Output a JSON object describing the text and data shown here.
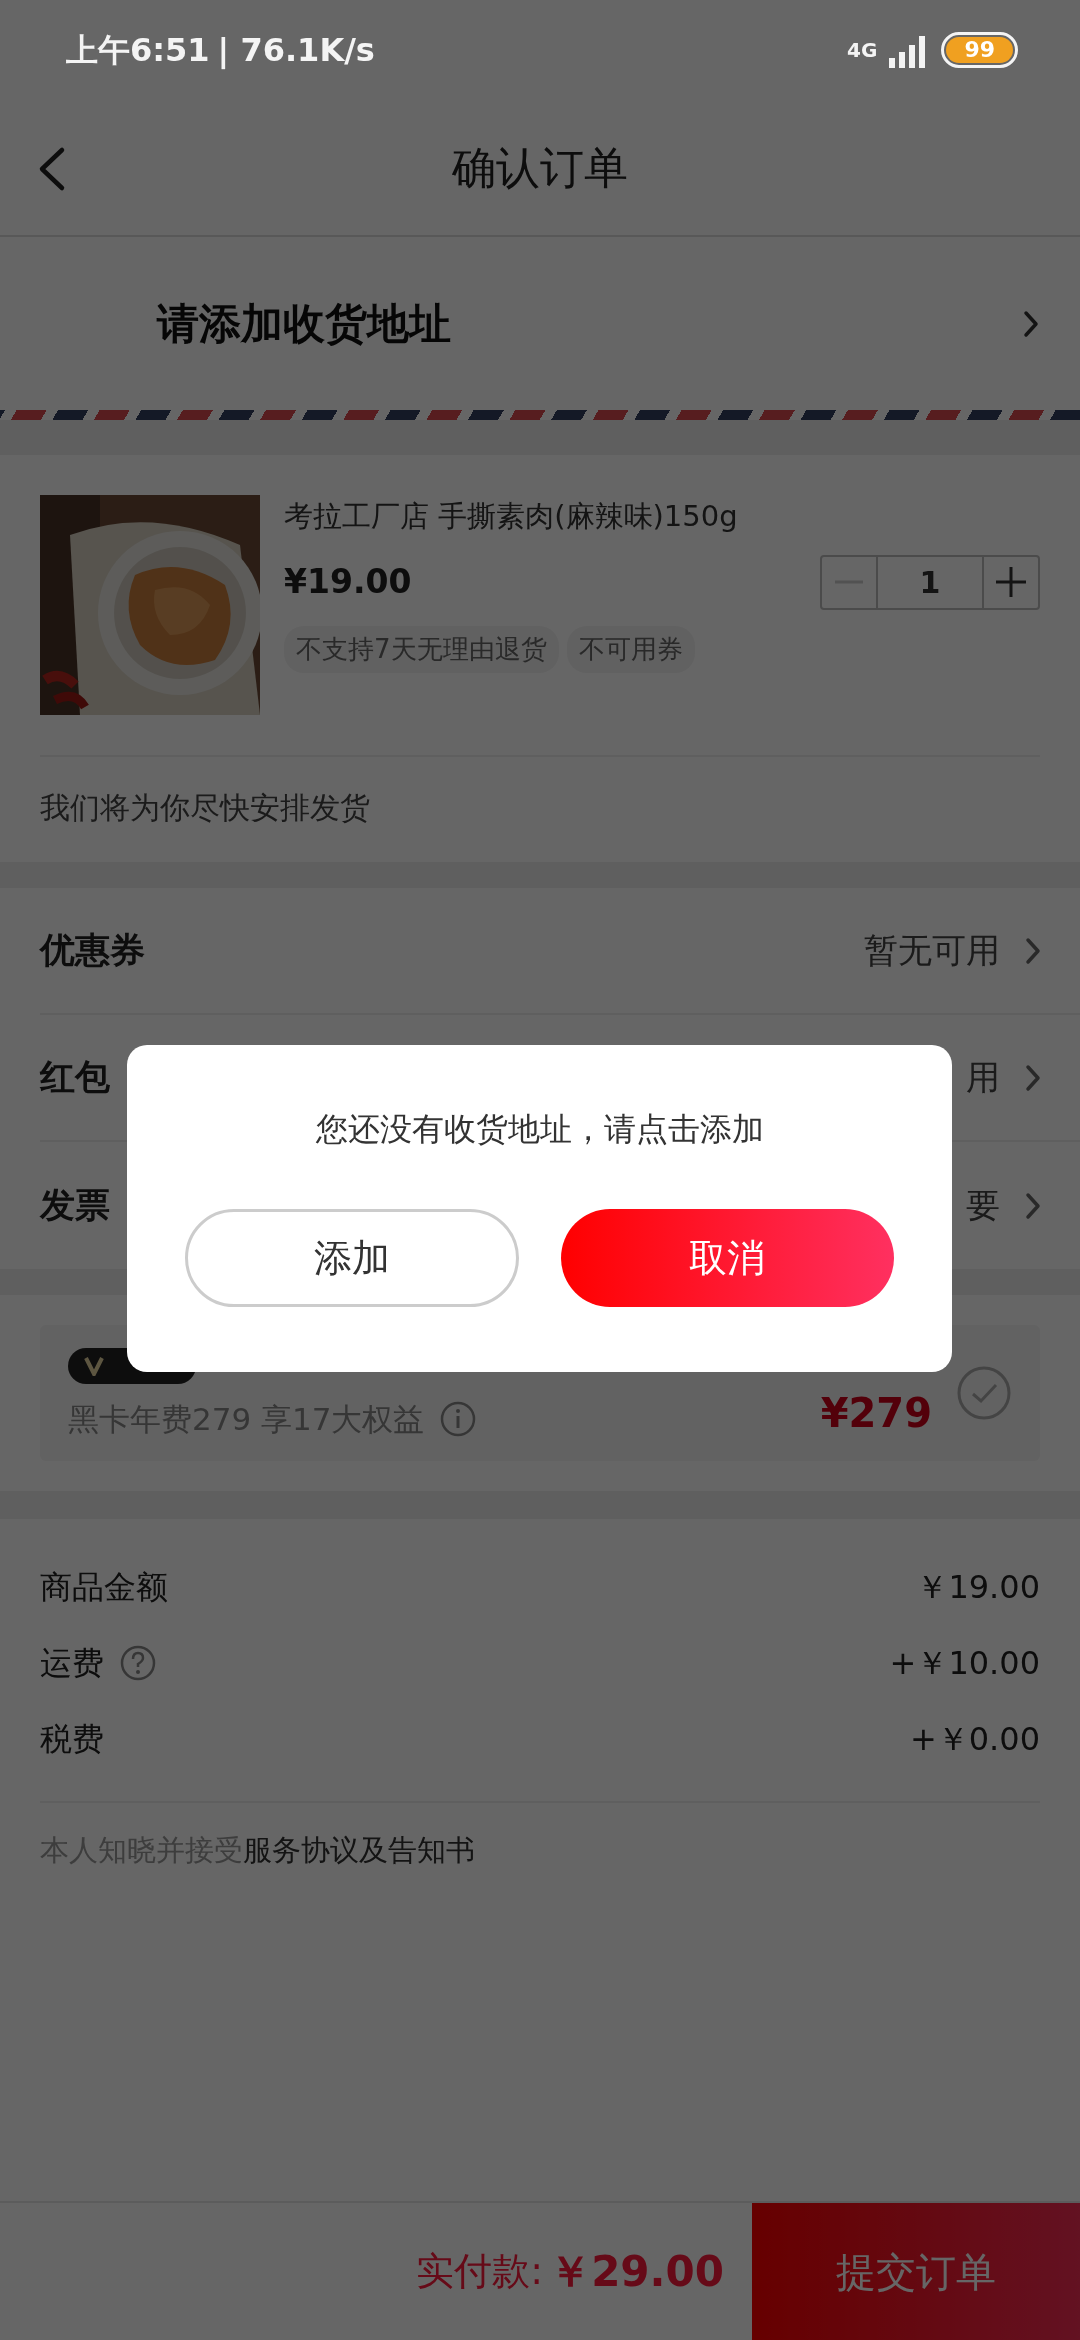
{
  "status_bar": {
    "time": "上午6:51",
    "speed": "| 76.1K/s",
    "network": "4G",
    "battery": "99"
  },
  "nav": {
    "title": "确认订单"
  },
  "address": {
    "prompt": "请添加收货地址"
  },
  "product": {
    "image": {
      "kind": "picture"
    },
    "name": "考拉工厂店 手撕素肉(麻辣味)150g",
    "price": "¥19.00",
    "quantity": "1",
    "decrement_disabled": true,
    "tags": [
      "不支持7天无理由退货",
      "不可用券"
    ],
    "shipping_note": "我们将为你尽快安排发货"
  },
  "options": [
    {
      "label": "优惠券",
      "value": "暂无可用"
    },
    {
      "label": "红包",
      "value": "用"
    },
    {
      "label": "发票",
      "value": "要"
    }
  ],
  "black_card": {
    "subtitle": "黑卡年费279 享17大权益",
    "price": "¥279",
    "checked": false
  },
  "summary": [
    {
      "label": "商品金额",
      "value": "￥19.00",
      "help": false
    },
    {
      "label": "运费",
      "value": "+￥10.00",
      "help": true
    },
    {
      "label": "税费",
      "value": "+￥0.00",
      "help": false
    }
  ],
  "agreement": {
    "text": "本人知晓并接受",
    "link": "服务协议及告知书"
  },
  "footer": {
    "total_label": "实付款:",
    "total": "￥29.00",
    "submit": "提交订单"
  },
  "dialog": {
    "message": "您还没有收货地址，请点击添加",
    "buttons": [
      {
        "label": "添加",
        "kind": "outline"
      },
      {
        "label": "取消",
        "kind": "primary"
      }
    ]
  }
}
